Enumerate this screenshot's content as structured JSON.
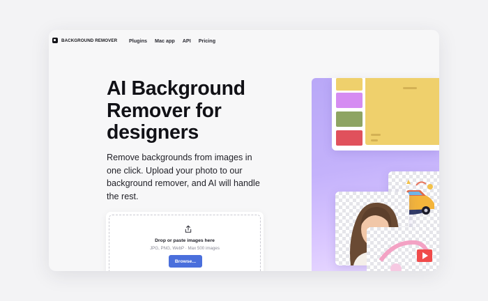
{
  "brand": {
    "name": "BACKGROUND REMOVER"
  },
  "nav": {
    "links": [
      "Plugins",
      "Mac app",
      "API",
      "Pricing"
    ]
  },
  "hero": {
    "title_lines": [
      "AI Background",
      "Remover for",
      "designers"
    ],
    "subtitle": "Remove backgrounds from images in one click. Upload your photo to our background remover, and AI will handle the rest."
  },
  "upload": {
    "icon": "share-upload-icon",
    "title": "Drop or paste images here",
    "hint": "JPG, PNG, WebP · Max 500 images",
    "button_label": "Browse..."
  },
  "colors": {
    "accent": "#4a6fdc",
    "visual_gradient": [
      "#b9a8f7",
      "#eadbff"
    ],
    "tiles": [
      "#efd06c",
      "#d58cf2",
      "#8ea463",
      "#e0515c"
    ]
  }
}
